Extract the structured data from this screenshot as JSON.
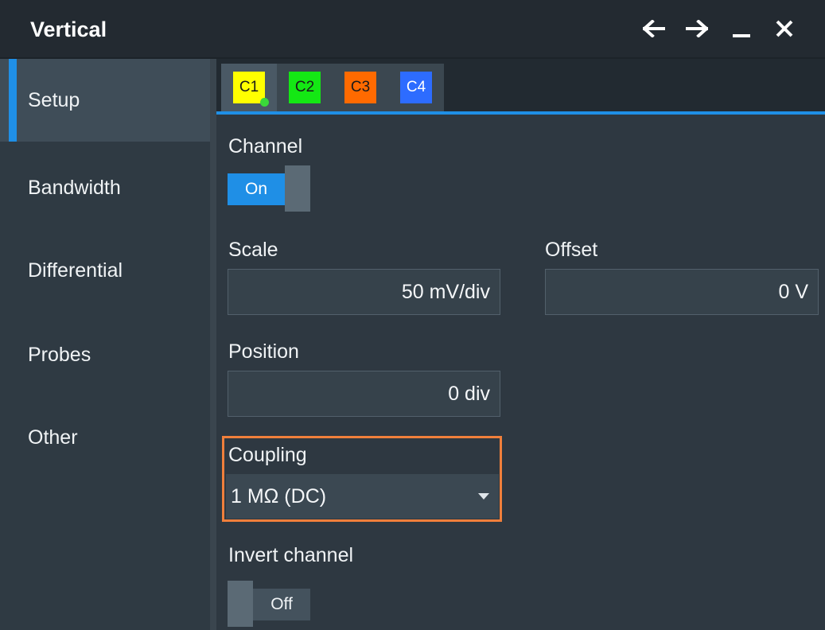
{
  "window": {
    "title": "Vertical",
    "controls": {
      "back_icon": "arrow-left-icon",
      "forward_icon": "arrow-right-icon",
      "minimize_icon": "minimize-icon",
      "close_icon": "close-icon"
    }
  },
  "sidebar": {
    "items": [
      {
        "label": "Setup",
        "active": true
      },
      {
        "label": "Bandwidth",
        "active": false
      },
      {
        "label": "Differential",
        "active": false
      },
      {
        "label": "Probes",
        "active": false
      },
      {
        "label": "Other",
        "active": false
      }
    ]
  },
  "tabs": [
    {
      "label": "C1",
      "color": "#ffff00",
      "active": true,
      "indicator_color": "#3ad83a"
    },
    {
      "label": "C2",
      "color": "#14e814",
      "active": false
    },
    {
      "label": "C3",
      "color": "#ff6a00",
      "active": false
    },
    {
      "label": "C4",
      "color": "#2d6cff",
      "active": false
    }
  ],
  "channel": {
    "label": "Channel",
    "state": "On"
  },
  "scale": {
    "label": "Scale",
    "value": "50 mV/div"
  },
  "offset": {
    "label": "Offset",
    "value": "0 V"
  },
  "position": {
    "label": "Position",
    "value": "0 div"
  },
  "coupling": {
    "label": "Coupling",
    "value": "1 MΩ (DC)"
  },
  "invert": {
    "label": "Invert channel",
    "state": "Off"
  },
  "colors": {
    "accent": "#1f8fe6",
    "highlight": "#f07f3b"
  }
}
